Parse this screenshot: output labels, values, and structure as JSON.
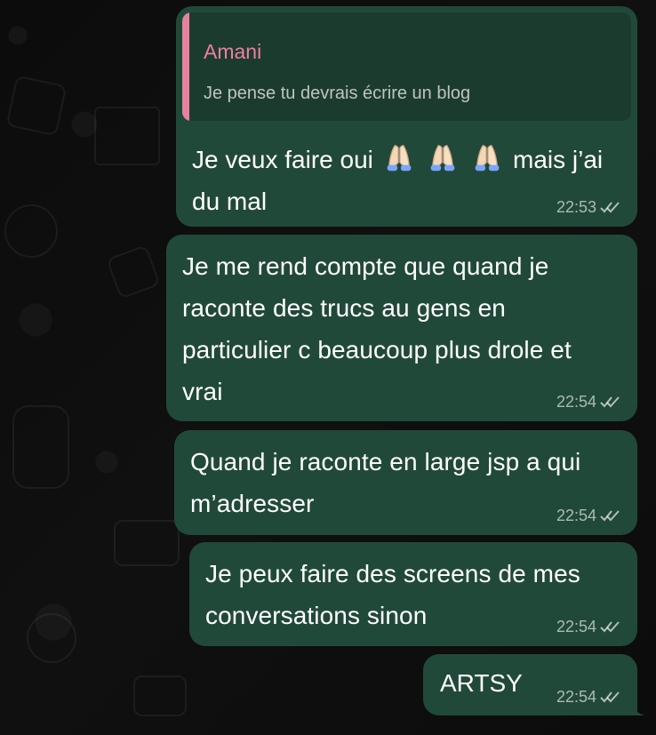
{
  "messages": [
    {
      "reply": {
        "author": "Amani",
        "text": "Je pense tu devrais écrire un blog"
      },
      "text_before": "Je veux faire oui",
      "text_after": "mais j’ai du mal",
      "time": "22:53",
      "status_icon": "double-check-icon"
    },
    {
      "text": "Je me rend compte que quand je raconte des trucs au gens en particulier c beaucoup plus drole et vrai",
      "time": "22:54",
      "status_icon": "double-check-icon"
    },
    {
      "text": "Quand je raconte en large jsp a qui m’adresser",
      "time": "22:54",
      "status_icon": "double-check-icon"
    },
    {
      "text": "Je peux faire des screens de mes conversations sinon",
      "time": "22:54",
      "status_icon": "double-check-icon"
    },
    {
      "text": "ARTSY",
      "time": "22:54",
      "status_icon": "double-check-icon"
    }
  ],
  "colors": {
    "background": "#0b0b0b",
    "outgoing_bubble": "#21493a",
    "reply_panel": "#1c3b2f",
    "reply_accent": "#e5839f",
    "reply_name": "#ef7f9f"
  },
  "emojis": [
    "folded-hands-icon",
    "folded-hands-icon",
    "folded-hands-icon"
  ]
}
